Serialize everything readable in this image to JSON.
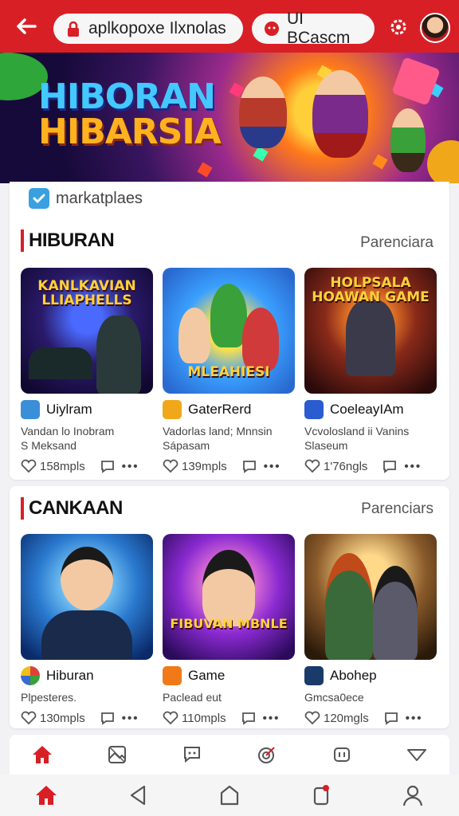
{
  "top_bar": {
    "pill1": {
      "icon": "lock-icon",
      "label": "aplkopoxe Ilxnolas"
    },
    "pill2": {
      "icon": "chat-icon",
      "label": "UI BCascm"
    },
    "settings_icon": "gear-icon",
    "avatar": "avatar"
  },
  "banner": {
    "line1": "HIBORAN",
    "line2": "HIBARSIA"
  },
  "marketplace": {
    "label": "markatplaes"
  },
  "sections": [
    {
      "title": "HIBURAN",
      "more": "Parenciara",
      "tiles": [
        {
          "thumb_title": "KANLKAVIAN LLIAPHELLS",
          "app_name": "Uiylram",
          "app_icon_color": "#3a8fd8",
          "desc1": "Vandan lo Inobram",
          "desc2": "S Meksand",
          "likes": "158mpls"
        },
        {
          "thumb_title": "MLEAHIESI",
          "app_name": "GaterRerd",
          "app_icon_color": "#f0a81a",
          "desc1": "Vadorlas land; Mnnsin",
          "desc2": "Sápasam",
          "likes": "139mpls"
        },
        {
          "thumb_title": "HOLPSALA HOAWAN GAME",
          "app_name": "CoeleayIAm",
          "app_icon_color": "#2a5bd0",
          "desc1": "Vcvolosland ii Vanins",
          "desc2": "Slaseum",
          "likes": "1'76ngls"
        }
      ]
    },
    {
      "title": "CANKAAN",
      "more": "Parenciars",
      "tiles": [
        {
          "thumb_title": "",
          "app_name": "Hiburan",
          "app_icon_color": "#e0403a",
          "desc1": "Plpesteres.",
          "desc2": "",
          "likes": "130mpls"
        },
        {
          "thumb_title": "FIBUVAN MBNLE",
          "app_name": "Game",
          "app_icon_color": "#f07a1a",
          "desc1": "Paclead eut",
          "desc2": "",
          "likes": "110mpls"
        },
        {
          "thumb_title": "",
          "app_name": "Abohep",
          "app_icon_color": "#1a3a6a",
          "desc1": "Gmcsa0ece",
          "desc2": "",
          "likes": "120mgls"
        }
      ]
    }
  ],
  "tab_bar": [
    "home-icon",
    "gallery-icon",
    "chat-icon",
    "target-icon",
    "gamepad-icon",
    "send-icon"
  ],
  "system_nav": [
    "home-icon",
    "back-icon",
    "circle-home-icon",
    "notification-icon",
    "profile-icon"
  ],
  "colors": {
    "brand": "#d91f26",
    "text": "#222222"
  }
}
